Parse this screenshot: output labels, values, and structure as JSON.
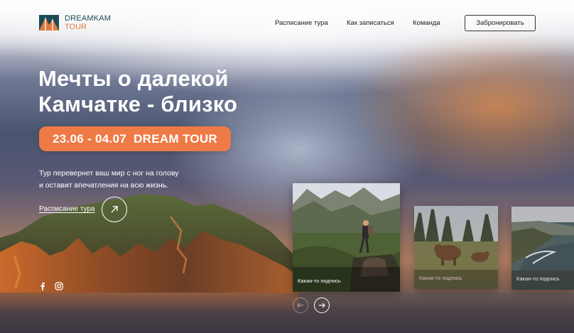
{
  "brand": {
    "line1": "DREAMKAM",
    "line2": "TOUR"
  },
  "nav": {
    "items": [
      "Расписание тура",
      "Как записаться",
      "Команда"
    ],
    "book_label": "Забронировать"
  },
  "hero": {
    "title_line1": "Мечты о далекой",
    "title_line2": "Камчатке - близко",
    "date_badge": "23.06 - 04.07  DREAM TOUR",
    "desc_line1": "Тур перевернет ваш мир с ног на голову",
    "desc_line2": "и оставит впечатления на всю жизнь.",
    "schedule_link": "Расписание тура"
  },
  "cards": [
    {
      "caption": "Какая-то подпись",
      "icon": "hiker-photo"
    },
    {
      "caption": "Какая-то подпись",
      "icon": "bears-photo"
    },
    {
      "caption": "Какая-то подпись",
      "icon": "coast-photo"
    }
  ],
  "social": [
    "facebook-icon",
    "instagram-icon"
  ],
  "colors": {
    "accent": "#ee7a46",
    "brand": "#1d4a55"
  }
}
